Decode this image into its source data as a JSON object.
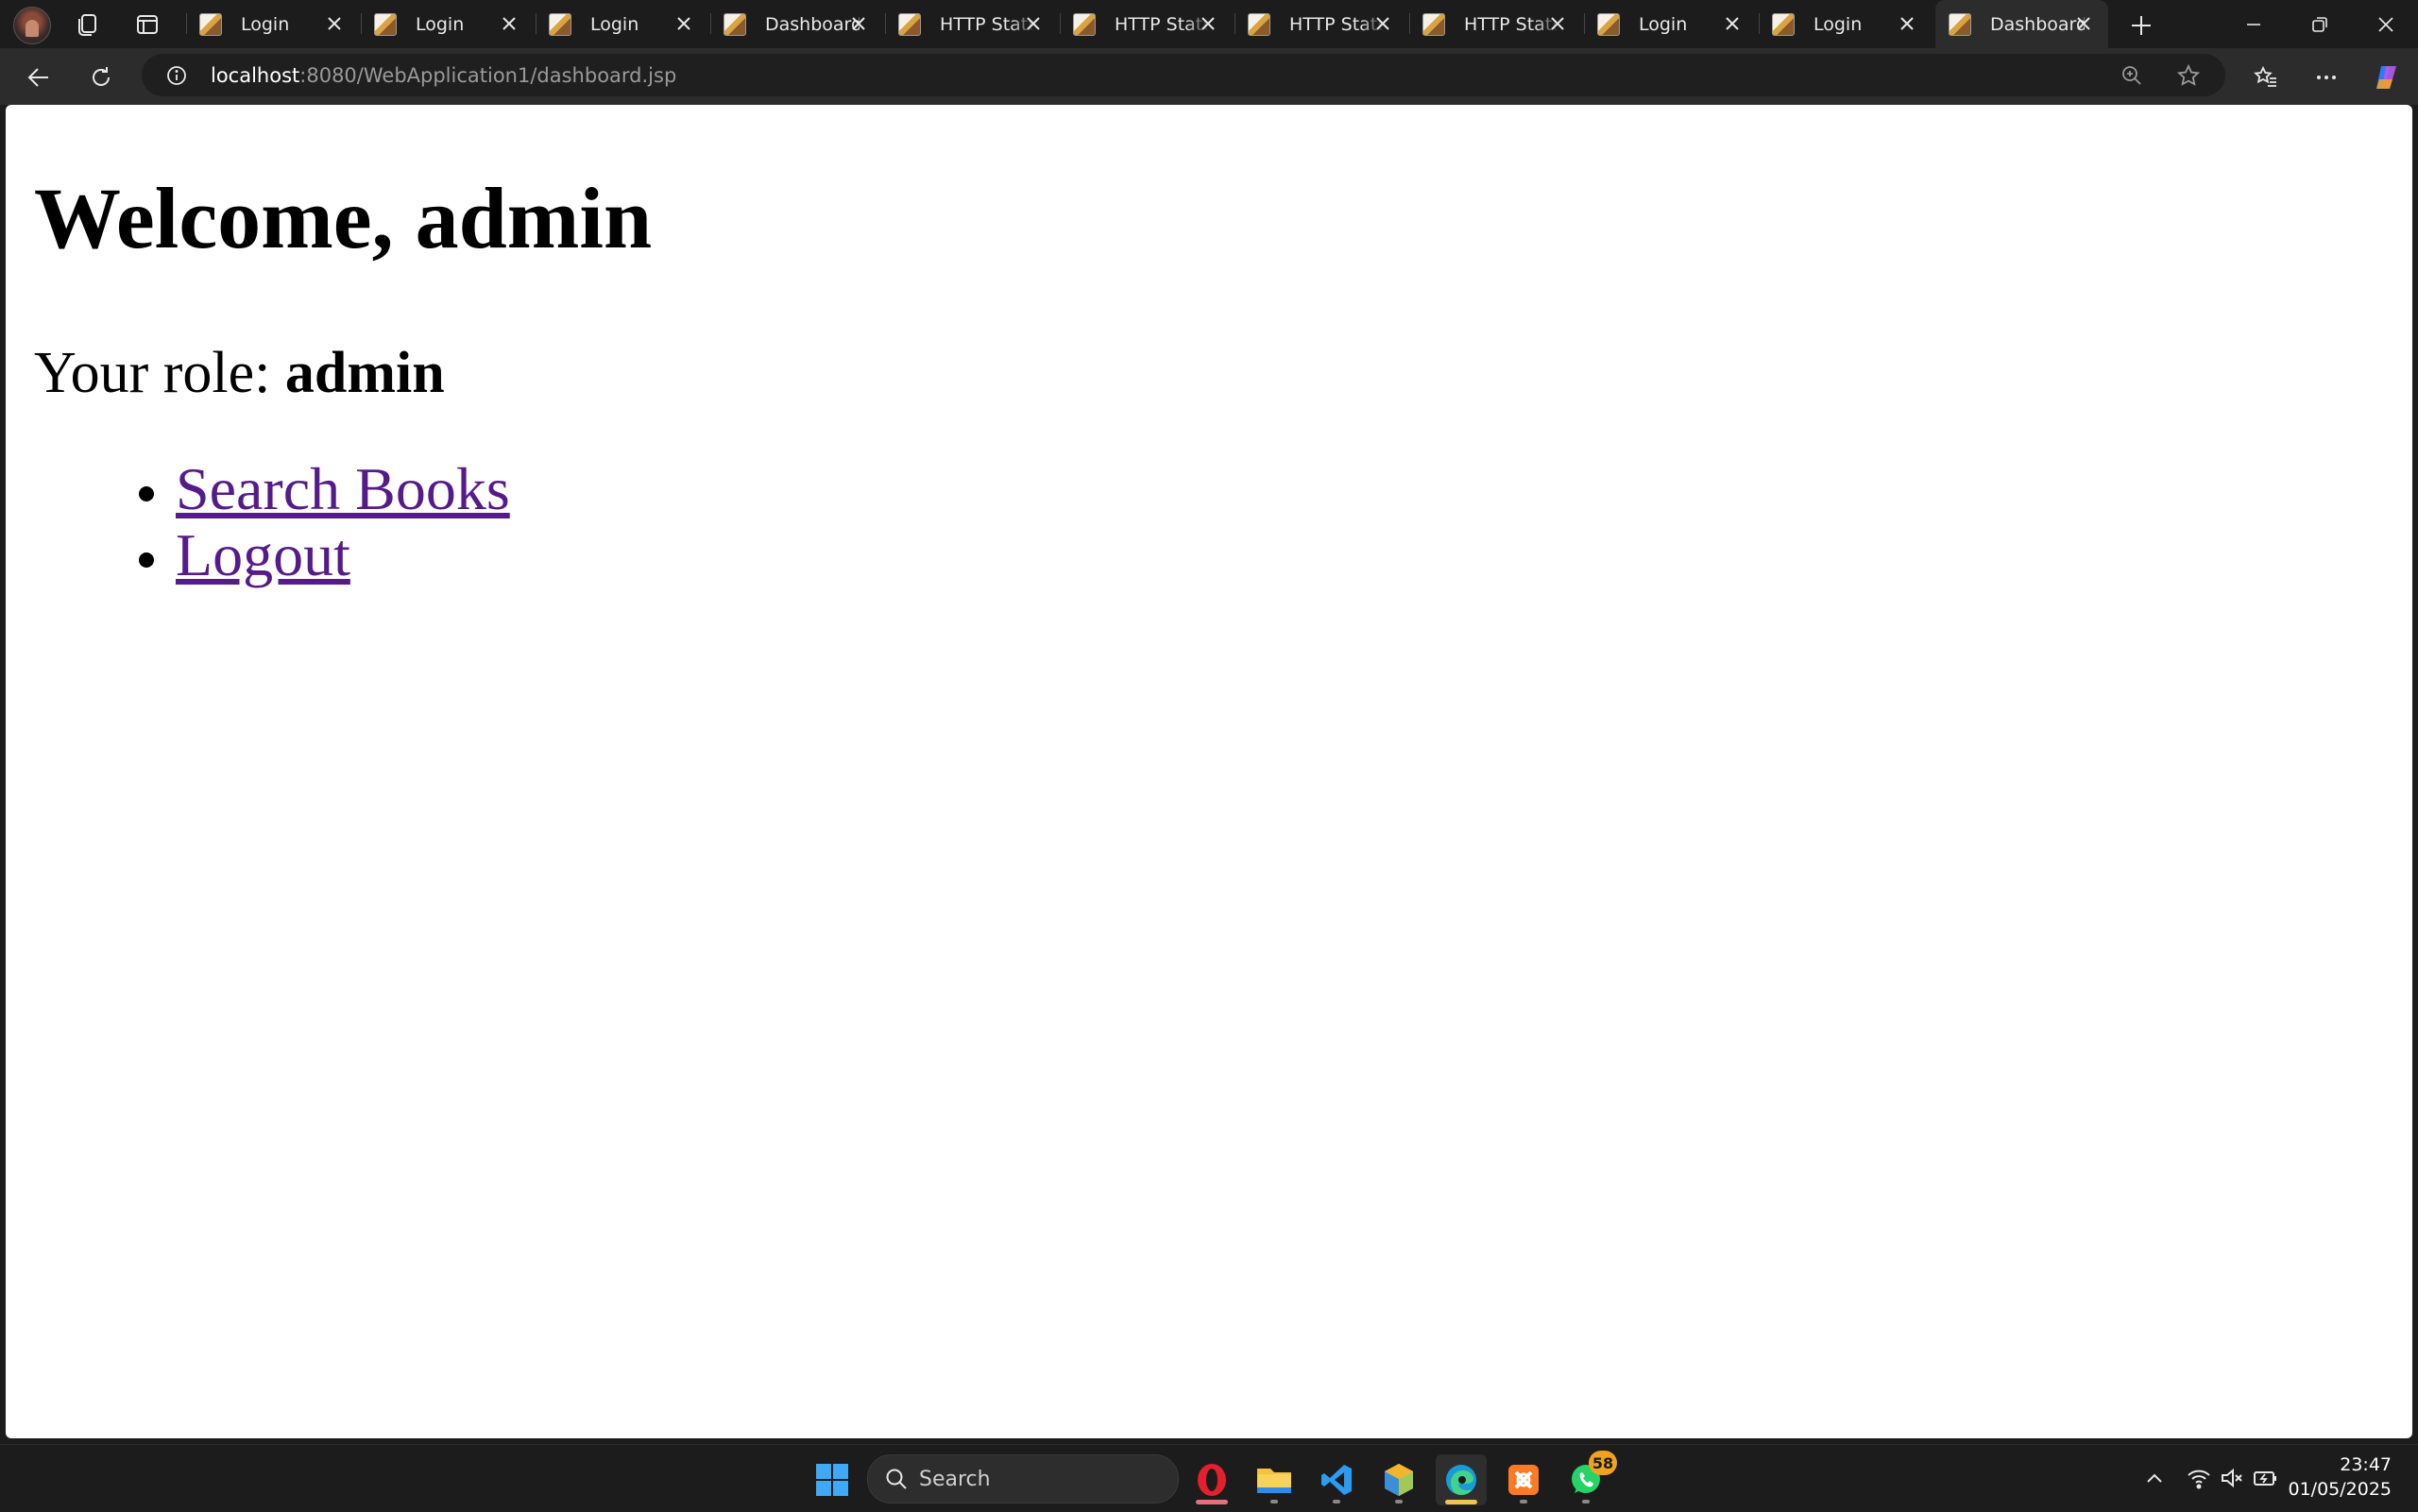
{
  "browser": {
    "tabs": [
      {
        "title": "Login"
      },
      {
        "title": "Login"
      },
      {
        "title": "Login"
      },
      {
        "title": "Dashboard"
      },
      {
        "title": "HTTP Status"
      },
      {
        "title": "HTTP Status"
      },
      {
        "title": "HTTP Status"
      },
      {
        "title": "HTTP Status"
      },
      {
        "title": "Login"
      },
      {
        "title": "Login"
      },
      {
        "title": "Dashboard",
        "active": true
      }
    ],
    "address_bar": {
      "host": "localhost",
      "path": ":8080/WebApplication1/dashboard.jsp"
    }
  },
  "page": {
    "heading": "Welcome, admin",
    "role_label": "Your role: ",
    "role_value": "admin",
    "links": [
      {
        "label": "Search Books"
      },
      {
        "label": "Logout"
      }
    ]
  },
  "taskbar": {
    "search_label": "Search",
    "apps": [
      "windows-start",
      "opera",
      "file-explorer",
      "vscode",
      "netbeans",
      "edge",
      "xampp",
      "whatsapp"
    ],
    "whatsapp_badge": "58",
    "clock": {
      "time": "23:47",
      "date": "01/05/2025"
    }
  },
  "colors": {
    "link_visited": "#551a8b",
    "chrome_bg": "#1c1c1c",
    "toolbar_bg": "#2c2c2c"
  }
}
